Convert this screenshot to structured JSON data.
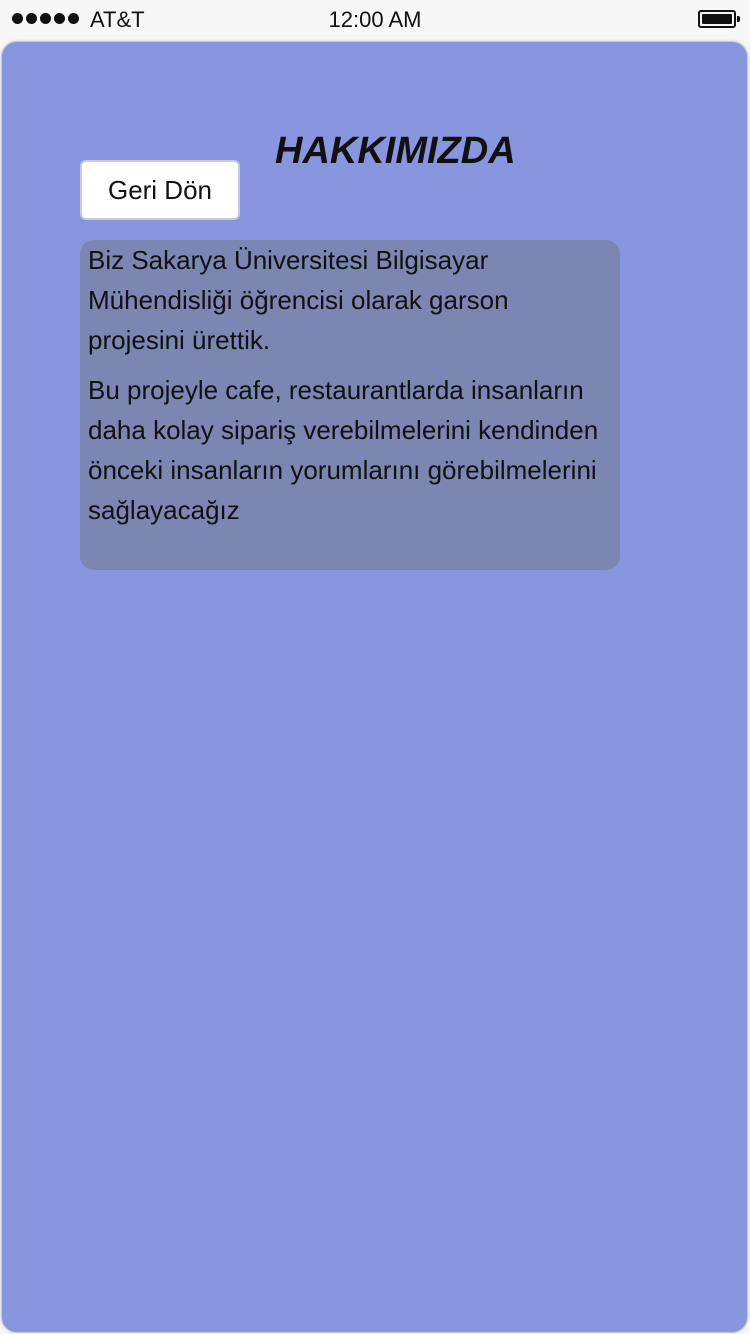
{
  "status_bar": {
    "carrier": "AT&T",
    "time": "12:00 AM"
  },
  "page": {
    "title": "HAKKIMIZDA",
    "back_label": "Geri Dön",
    "paragraphs": [
      "Biz Sakarya Üniversitesi Bilgisayar Mühendisliği öğrencisi olarak garson projesini ürettik.",
      "Bu projeyle cafe, restaurantlarda insanların daha kolay sipariş verebilmelerini kendinden önceki insanların yorumlarını görebilmelerini sağlayacağız"
    ]
  },
  "colors": {
    "background": "#8896df",
    "text_box": "#7b86b2"
  }
}
